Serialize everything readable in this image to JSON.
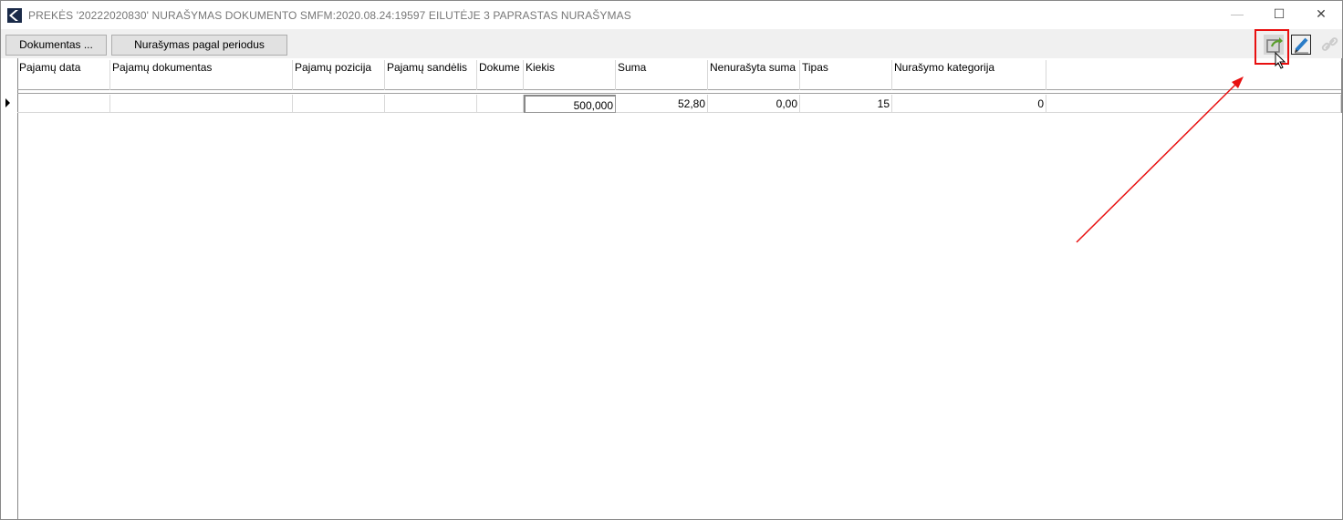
{
  "window": {
    "title": "PREKĖS '20222020830' NURAŠYMAS DOKUMENTO SMFM:2020.08.24:19597 EILUTĖJE 3 PAPRASTAS NURAŠYMAS",
    "minimize": "—",
    "maximize": "☐",
    "close": "✕"
  },
  "toolbar": {
    "documents_label": "Dokumentas ...",
    "period_writeoff_label": "Nurašymas pagal periodus",
    "icons": [
      "export-icon",
      "edit-pencil-icon",
      "link-icon"
    ]
  },
  "table": {
    "columns": [
      "Pajamų data",
      "Pajamų dokumentas",
      "Pajamų pozicija",
      "Pajamų sandėlis",
      "Dokume",
      "Kiekis",
      "Suma",
      "Nenurašyta suma",
      "Tipas",
      "Nurašymo kategorija"
    ],
    "rows": [
      [
        "",
        "",
        "",
        "",
        "",
        "500,000",
        "52,80",
        "0,00",
        "15",
        "0"
      ]
    ]
  },
  "colors": {
    "highlight": "#e81010",
    "arrow": "#e81010"
  }
}
